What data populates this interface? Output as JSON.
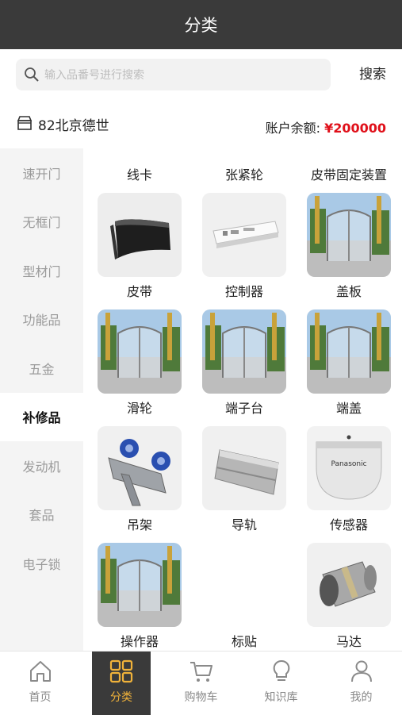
{
  "header": {
    "title": "分类"
  },
  "search": {
    "placeholder": "输入品番号进行搜索",
    "button": "搜索"
  },
  "store": {
    "name": "82北京德世",
    "balance_label": "账户余额: ",
    "balance_value": "¥200000"
  },
  "sidebar": {
    "items": [
      {
        "label": "速开门"
      },
      {
        "label": "无框门"
      },
      {
        "label": "型材门"
      },
      {
        "label": "功能品"
      },
      {
        "label": "五金"
      },
      {
        "label": "补修品"
      },
      {
        "label": "发动机"
      },
      {
        "label": "套品"
      },
      {
        "label": "电子锁"
      }
    ],
    "active_index": 5
  },
  "grid": {
    "top_labels": [
      "线卡",
      "张紧轮",
      "皮带固定装置"
    ],
    "items": [
      {
        "label": "皮带",
        "image": "belt-image"
      },
      {
        "label": "控制器",
        "image": "controller-image"
      },
      {
        "label": "盖板",
        "image": "door-photo"
      },
      {
        "label": "滑轮",
        "image": "door-photo"
      },
      {
        "label": "端子台",
        "image": "door-photo"
      },
      {
        "label": "端盖",
        "image": "door-photo"
      },
      {
        "label": "吊架",
        "image": "hanger-image"
      },
      {
        "label": "导轨",
        "image": "rail-image"
      },
      {
        "label": "传感器",
        "image": "sensor-image"
      },
      {
        "label": "操作器",
        "image": "door-photo"
      },
      {
        "label": "标贴",
        "image": ""
      },
      {
        "label": "马达",
        "image": "motor-image"
      }
    ],
    "sensor_brand": "Panasonic"
  },
  "tabbar": {
    "items": [
      {
        "label": "首页",
        "icon": "home-icon"
      },
      {
        "label": "分类",
        "icon": "grid-icon"
      },
      {
        "label": "购物车",
        "icon": "cart-icon"
      },
      {
        "label": "知识库",
        "icon": "bulb-icon"
      },
      {
        "label": "我的",
        "icon": "user-icon"
      }
    ],
    "active_index": 1
  },
  "colors": {
    "header_bg": "#3a3a3a",
    "accent": "#f0b23a",
    "price": "#e0101a"
  }
}
